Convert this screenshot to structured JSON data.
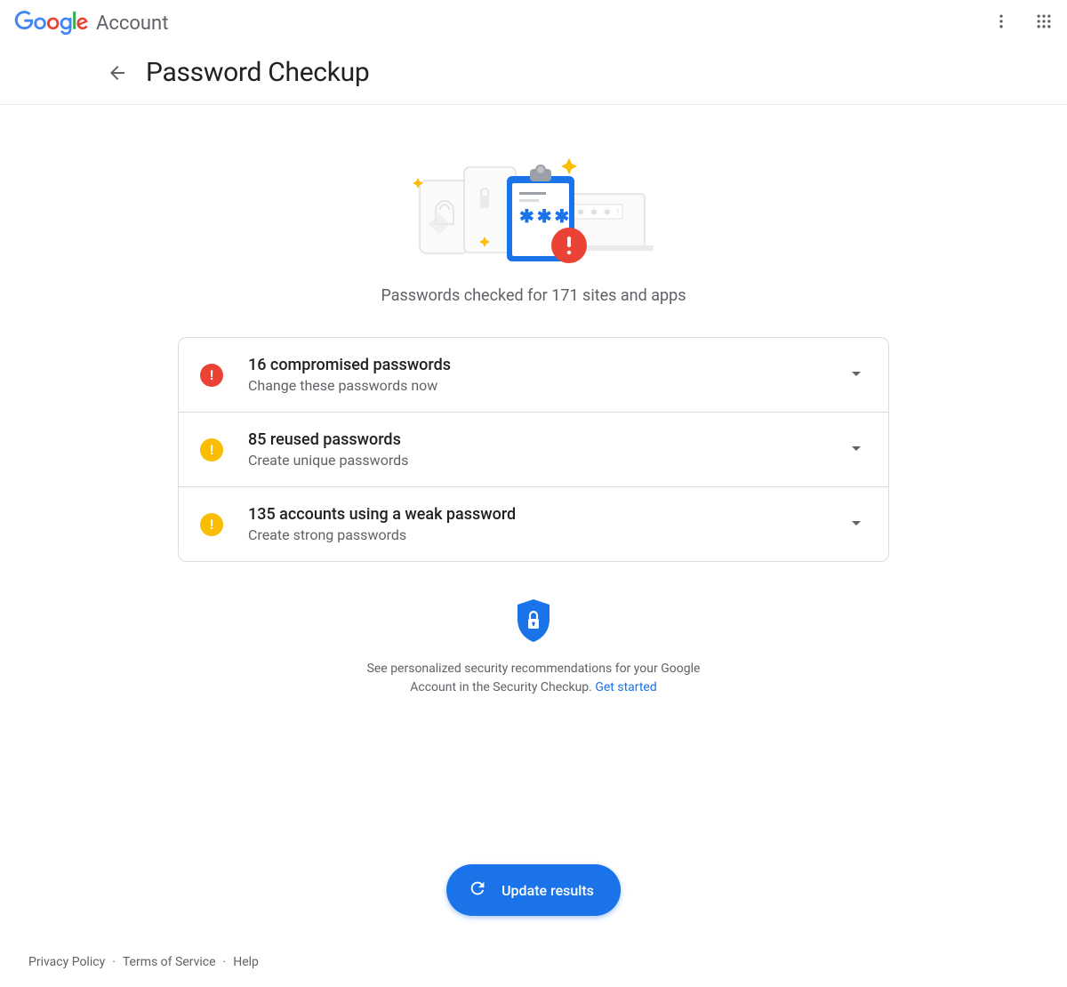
{
  "header": {
    "product": "Account",
    "page_title": "Password Checkup"
  },
  "summary": "Passwords checked for 171 sites and apps",
  "cards": [
    {
      "severity": "red",
      "title": "16 compromised passwords",
      "subtitle": "Change these passwords now"
    },
    {
      "severity": "yellow",
      "title": "85 reused passwords",
      "subtitle": "Create unique passwords"
    },
    {
      "severity": "yellow",
      "title": "135 accounts using a weak password",
      "subtitle": "Create strong passwords"
    }
  ],
  "recommendation": {
    "text": "See personalized security recommendations for your Google Account in the Security Checkup. ",
    "link_label": "Get started"
  },
  "update_button": "Update results",
  "footer": {
    "links": [
      "Privacy Policy",
      "Terms of Service",
      "Help"
    ]
  }
}
